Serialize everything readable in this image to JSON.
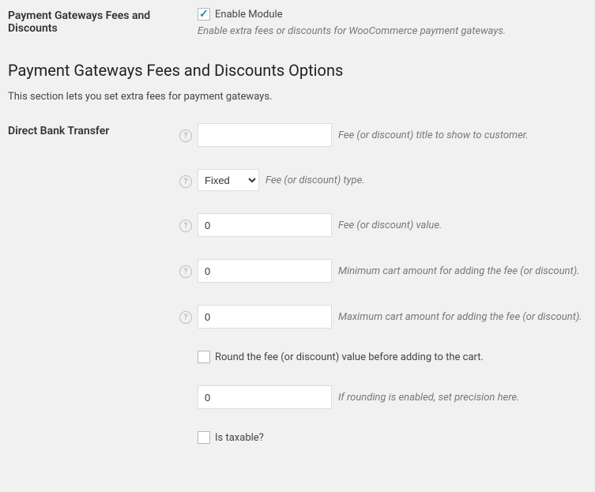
{
  "top": {
    "label": "Payment Gateways Fees and Discounts",
    "checkbox_label": "Enable Module",
    "checked": true,
    "description": "Enable extra fees or discounts for WooCommerce payment gateways."
  },
  "section": {
    "title": "Payment Gateways Fees and Discounts Options",
    "subtitle": "This section lets you set extra fees for payment gateways."
  },
  "gateway": {
    "label": "Direct Bank Transfer",
    "fields": {
      "title": {
        "value": "",
        "desc": "Fee (or discount) title to show to customer."
      },
      "type": {
        "value": "Fixed",
        "desc": "Fee (or discount) type."
      },
      "value": {
        "value": "0",
        "desc": "Fee (or discount) value."
      },
      "min_cart": {
        "value": "0",
        "desc": "Minimum cart amount for adding the fee (or discount)."
      },
      "max_cart": {
        "value": "0",
        "desc": "Maximum cart amount for adding the fee (or discount)."
      },
      "round": {
        "checked": false,
        "label": "Round the fee (or discount) value before adding to the cart."
      },
      "precision": {
        "value": "0",
        "desc": "If rounding is enabled, set precision here."
      },
      "taxable": {
        "checked": false,
        "label": "Is taxable?"
      }
    }
  }
}
